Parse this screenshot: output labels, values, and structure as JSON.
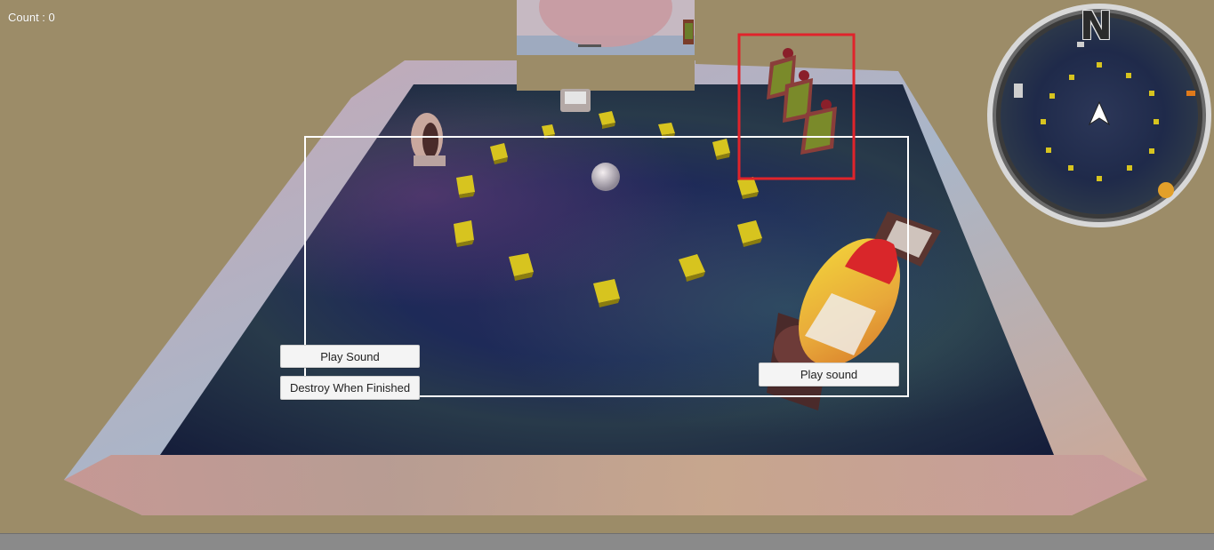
{
  "hud": {
    "count_label": "Count : 0"
  },
  "buttons": {
    "play_sound_left": "Play Sound",
    "destroy_when_finished": "Destroy When Finished",
    "play_sound_right": "Play sound"
  },
  "minimap": {
    "north_label": "N"
  },
  "colors": {
    "background": "#9c8c68",
    "selection_box": "#e0242b",
    "frame_box": "#ffffff",
    "pickup": "#d9c61e"
  },
  "icons": {
    "player_marker": "arrow-up-icon",
    "pickup": "cube-icon"
  }
}
